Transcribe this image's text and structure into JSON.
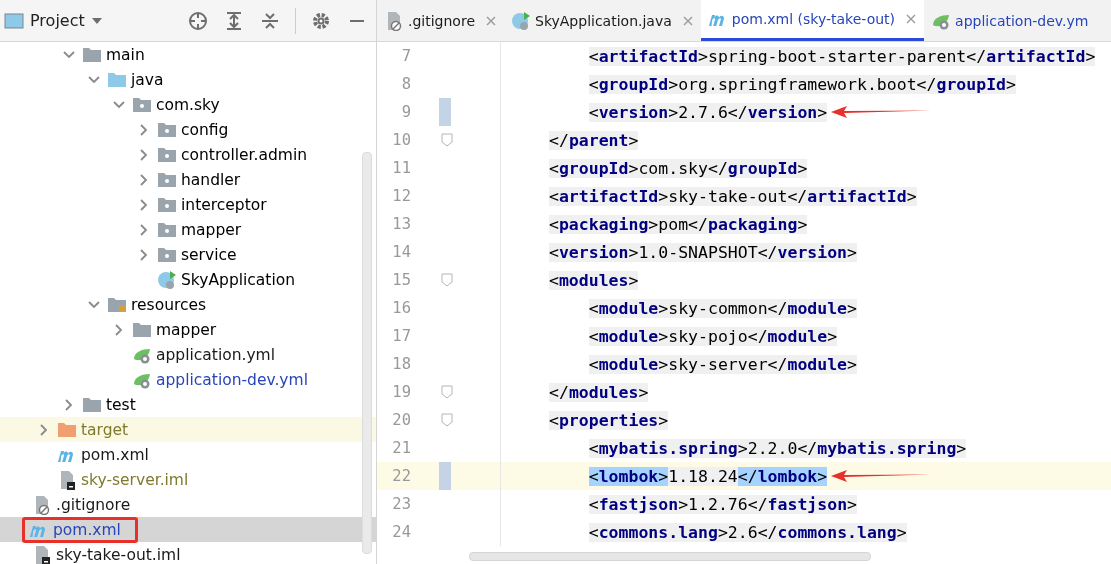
{
  "project_panel": {
    "title": "Project",
    "tree": [
      {
        "children": [
          {
            "children": [
              {
                "label": "main",
                "kind": "folder",
                "expanded": true,
                "children": [
                  {
                    "label": "java",
                    "kind": "source-folder",
                    "expanded": true,
                    "children": [
                      {
                        "label": "com.sky",
                        "kind": "package",
                        "expanded": true,
                        "children": [
                          {
                            "label": "config",
                            "kind": "package",
                            "expanded": false
                          },
                          {
                            "label": "controller.admin",
                            "kind": "package",
                            "expanded": false
                          },
                          {
                            "label": "handler",
                            "kind": "package",
                            "expanded": false
                          },
                          {
                            "label": "interceptor",
                            "kind": "package",
                            "expanded": false
                          },
                          {
                            "label": "mapper",
                            "kind": "package",
                            "expanded": false
                          },
                          {
                            "label": "service",
                            "kind": "package",
                            "expanded": false
                          },
                          {
                            "label": "SkyApplication",
                            "kind": "spring-class"
                          }
                        ]
                      }
                    ]
                  },
                  {
                    "label": "resources",
                    "kind": "resources-folder",
                    "expanded": true,
                    "children": [
                      {
                        "label": "mapper",
                        "kind": "folder",
                        "expanded": false
                      },
                      {
                        "label": "application.yml",
                        "kind": "spring-config",
                        "color": "#1a1a1a"
                      },
                      {
                        "label": "application-dev.yml",
                        "kind": "spring-config",
                        "color": "#2845b8"
                      }
                    ]
                  }
                ]
              },
              {
                "label": "test",
                "kind": "folder",
                "expanded": false
              }
            ]
          },
          {
            "label": "target",
            "kind": "excluded-folder",
            "expanded": false,
            "color": "#7f7a2e",
            "highlighted": true
          },
          {
            "label": "pom.xml",
            "kind": "maven",
            "color": "#1a1a1a"
          },
          {
            "label": "sky-server.iml",
            "kind": "iml",
            "color": "#7f7a2e"
          }
        ]
      },
      {
        "label": ".gitignore",
        "kind": "git",
        "color": "#1a1a1a"
      },
      {
        "label": "pom.xml",
        "kind": "maven",
        "color": "#2845b8",
        "selected": true,
        "boxed": true
      },
      {
        "label": "sky-take-out.iml",
        "kind": "iml",
        "color": "#1a1a1a"
      }
    ]
  },
  "editor": {
    "tabs": [
      {
        "label": ".gitignore",
        "kind": "git",
        "selected": false,
        "closable": true,
        "color": "#1a1a1a"
      },
      {
        "label": "SkyApplication.java",
        "kind": "spring-class",
        "selected": false,
        "closable": true,
        "color": "#1a1a1a"
      },
      {
        "label": "pom.xml (sky-take-out)",
        "kind": "maven",
        "selected": true,
        "closable": true,
        "color": "#2845b8"
      },
      {
        "label": "application-dev.ym",
        "kind": "spring-config",
        "selected": false,
        "closable": false,
        "color": "#2845b8"
      }
    ],
    "lines": [
      {
        "number": "7",
        "code": "    <artifactId>spring-boot-starter-parent</artifactId>"
      },
      {
        "number": "8",
        "code": "    <groupId>org.springframework.boot</groupId>"
      },
      {
        "number": "9",
        "code": "    <version>2.7.6</version>",
        "changed": true,
        "annotated": true
      },
      {
        "number": "10",
        "code": "</parent>",
        "fold": true
      },
      {
        "number": "11",
        "code": "<groupId>com.sky</groupId>"
      },
      {
        "number": "12",
        "code": "<artifactId>sky-take-out</artifactId>"
      },
      {
        "number": "13",
        "code": "<packaging>pom</packaging>"
      },
      {
        "number": "14",
        "code": "<version>1.0-SNAPSHOT</version>"
      },
      {
        "number": "15",
        "code": "<modules>",
        "fold": true
      },
      {
        "number": "16",
        "code": "    <module>sky-common</module>"
      },
      {
        "number": "17",
        "code": "    <module>sky-pojo</module>"
      },
      {
        "number": "18",
        "code": "    <module>sky-server</module>"
      },
      {
        "number": "19",
        "code": "</modules>",
        "fold": true
      },
      {
        "number": "20",
        "code": "<properties>",
        "fold": true
      },
      {
        "number": "21",
        "code": "    <mybatis.spring>2.2.0</mybatis.spring>"
      },
      {
        "number": "22",
        "code": "    <lombok>1.18.24</lombok>",
        "changed": true,
        "annotated": true,
        "current": true,
        "tag_match": true
      },
      {
        "number": "23",
        "code": "    <fastjson>1.2.76</fastjson>"
      },
      {
        "number": "24",
        "code": "    <commons.lang>2.6</commons.lang>"
      }
    ]
  }
}
